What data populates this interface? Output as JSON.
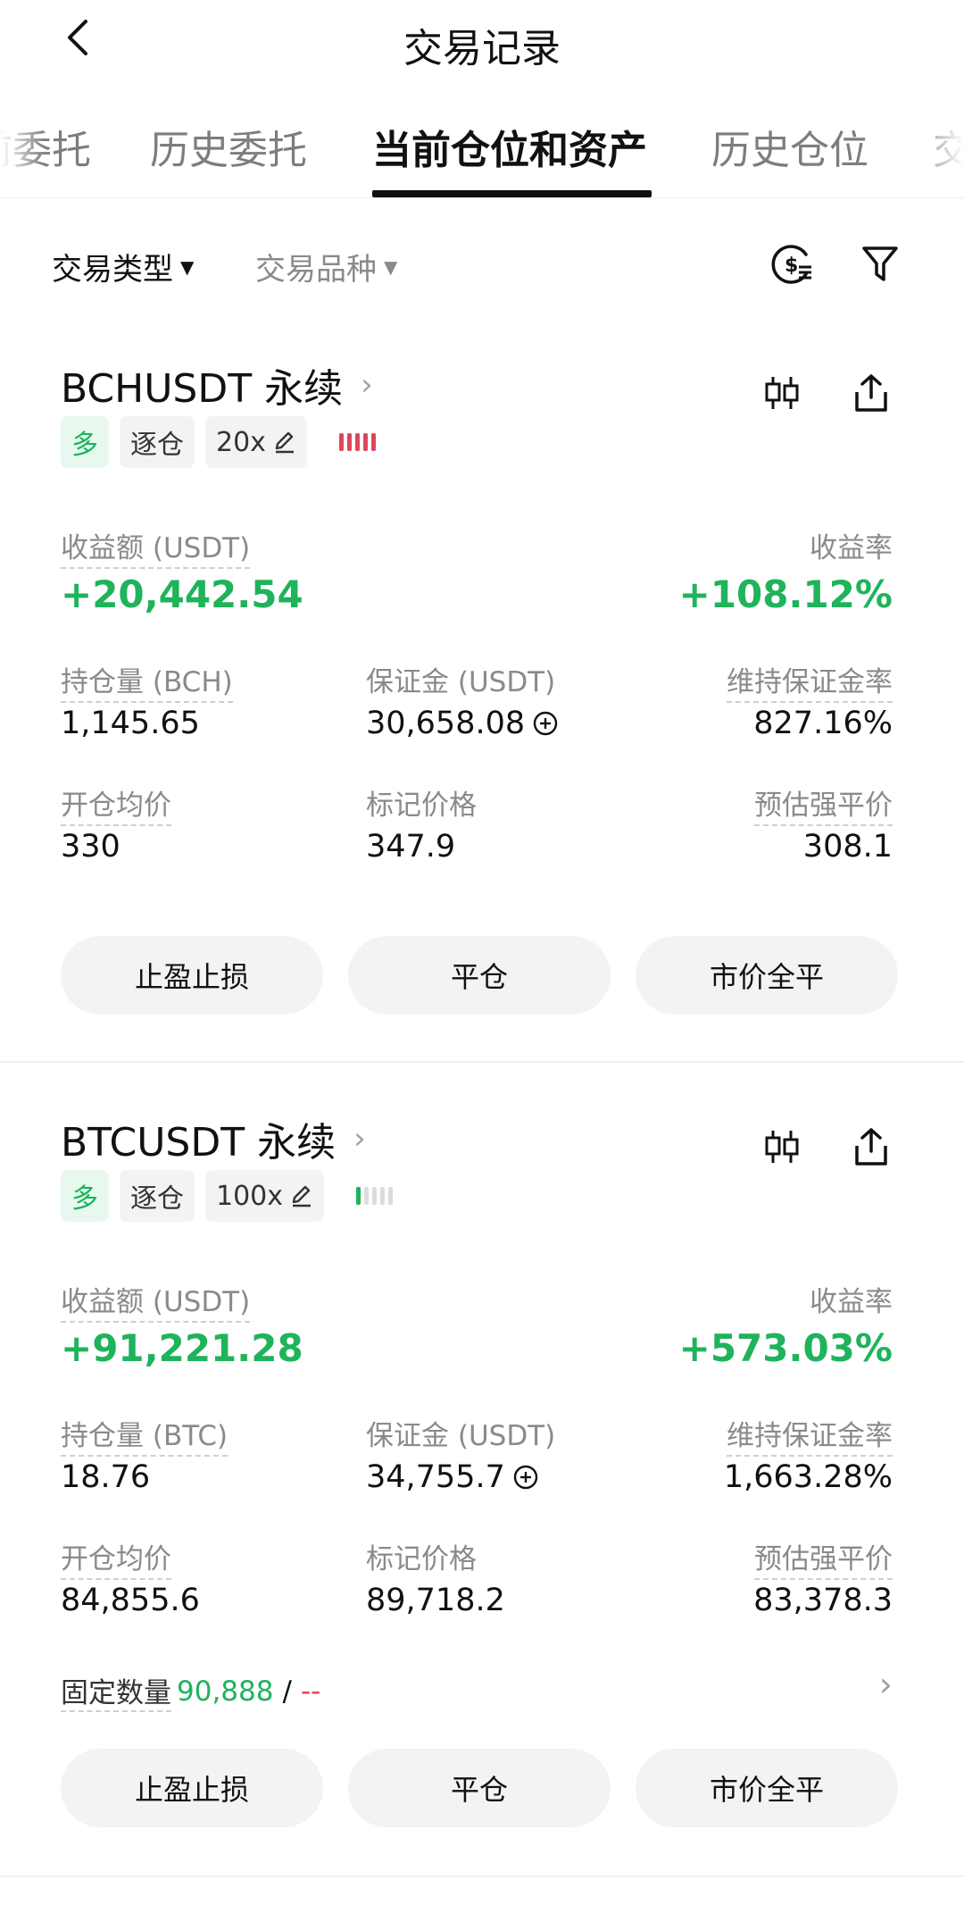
{
  "header": {
    "title": "交易记录",
    "back_icon": "chevron-left-icon"
  },
  "tabs": [
    {
      "label": "前委托",
      "active": false
    },
    {
      "label": "历史委托",
      "active": false
    },
    {
      "label": "当前仓位和资产",
      "active": true
    },
    {
      "label": "历史仓位",
      "active": false
    },
    {
      "label": "交",
      "active": false
    }
  ],
  "filters": {
    "trade_type": "交易类型",
    "instrument": "交易品种",
    "icons": [
      "coin-list-icon",
      "filter-icon"
    ]
  },
  "colors": {
    "green": "#1fb35b",
    "red_bar": "#e0445a",
    "tag_bg": "#f3f3f3",
    "long_tag_bg": "#e8f8ee"
  },
  "positions": [
    {
      "symbol": "BCHUSDT 永续",
      "side": "多",
      "margin_mode": "逐仓",
      "leverage": "20x",
      "pnl_label": "收益额 (USDT)",
      "pnl_value": "+20,442.54",
      "roi_label": "收益率",
      "roi_value": "+108.12%",
      "size_label": "持仓量 (BCH)",
      "size_value": "1,145.65",
      "margin_label": "保证金 (USDT)",
      "margin_value": "30,658.08",
      "mmr_label": "维持保证金率",
      "mmr_value": "827.16%",
      "entry_label": "开仓均价",
      "entry_value": "330",
      "mark_label": "标记价格",
      "mark_value": "347.9",
      "liq_label": "预估强平价",
      "liq_value": "308.1",
      "buttons": {
        "tpsl": "止盈止损",
        "close": "平仓",
        "market_close": "市价全平"
      }
    },
    {
      "symbol": "BTCUSDT 永续",
      "side": "多",
      "margin_mode": "逐仓",
      "leverage": "100x",
      "pnl_label": "收益额 (USDT)",
      "pnl_value": "+91,221.28",
      "roi_label": "收益率",
      "roi_value": "+573.03%",
      "size_label": "持仓量 (BTC)",
      "size_value": "18.76",
      "margin_label": "保证金 (USDT)",
      "margin_value": "34,755.7",
      "mmr_label": "维持保证金率",
      "mmr_value": "1,663.28%",
      "entry_label": "开仓均价",
      "entry_value": "84,855.6",
      "mark_label": "标记价格",
      "mark_value": "89,718.2",
      "liq_label": "预估强平价",
      "liq_value": "83,378.3",
      "fixed_label": "固定数量",
      "fixed_value": "90,888",
      "fixed_slash": "/",
      "fixed_empty": "--",
      "buttons": {
        "tpsl": "止盈止损",
        "close": "平仓",
        "market_close": "市价全平"
      }
    }
  ]
}
